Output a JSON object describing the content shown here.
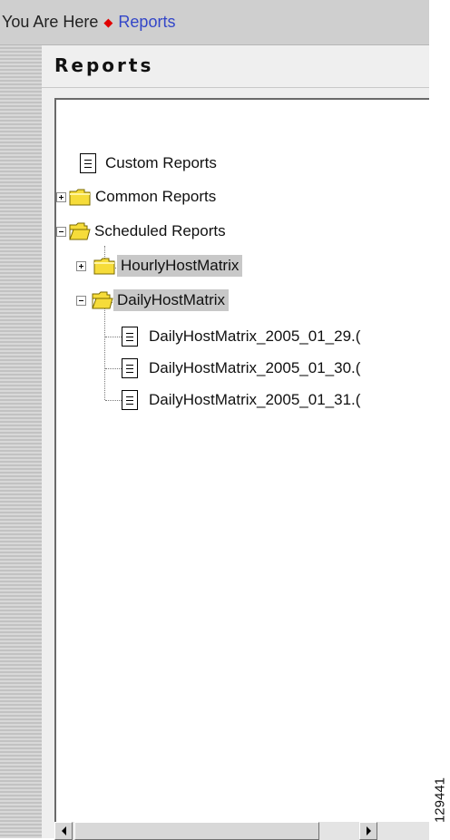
{
  "breadcrumb": {
    "prefix": "You Are Here",
    "separator_icon": "red-diamond-icon",
    "current": "Reports"
  },
  "page": {
    "title": "Reports"
  },
  "tree": {
    "custom_reports": {
      "label": "Custom Reports",
      "icon": "document-icon"
    },
    "common_reports": {
      "label": "Common Reports",
      "icon": "folder-icon",
      "expanded": false
    },
    "scheduled_reports": {
      "label": "Scheduled Reports",
      "icon": "open-folder-icon",
      "expanded": true
    },
    "hourly_host_matrix": {
      "label": "HourlyHostMatrix",
      "icon": "folder-icon",
      "expanded": false,
      "highlighted": true
    },
    "daily_host_matrix": {
      "label": "DailyHostMatrix",
      "icon": "open-folder-icon",
      "expanded": true,
      "highlighted": true
    },
    "daily_files": [
      {
        "label": "DailyHostMatrix_2005_01_29.(",
        "icon": "document-icon"
      },
      {
        "label": "DailyHostMatrix_2005_01_30.(",
        "icon": "document-icon"
      },
      {
        "label": "DailyHostMatrix_2005_01_31.(",
        "icon": "document-icon"
      }
    ]
  },
  "figure_id": "129441",
  "colors": {
    "breadcrumb_bg": "#cfcfcf",
    "link": "#3346c8",
    "diamond": "#e00000",
    "selection_bg": "#c8c8c8",
    "folder_yellow": "#f6dc3a"
  }
}
